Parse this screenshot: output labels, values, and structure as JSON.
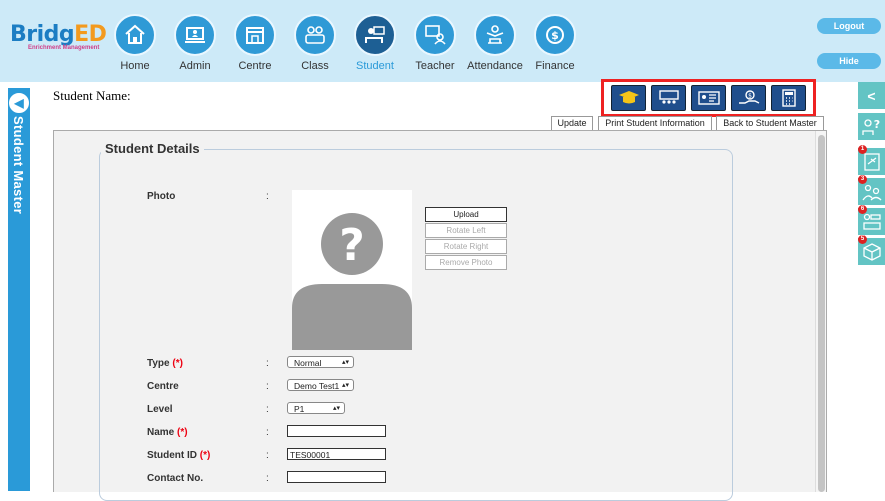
{
  "brand": {
    "name_part1": "Bridg",
    "name_part2": "ED",
    "tagline": "Enrichment Management"
  },
  "nav": [
    {
      "label": "Home",
      "icon": "home-icon"
    },
    {
      "label": "Admin",
      "icon": "admin-icon"
    },
    {
      "label": "Centre",
      "icon": "centre-icon"
    },
    {
      "label": "Class",
      "icon": "class-icon"
    },
    {
      "label": "Student",
      "icon": "student-icon",
      "active": true
    },
    {
      "label": "Teacher",
      "icon": "teacher-icon"
    },
    {
      "label": "Attendance",
      "icon": "attendance-icon"
    },
    {
      "label": "Finance",
      "icon": "finance-icon"
    }
  ],
  "top_buttons": {
    "logout": "Logout",
    "hide": "Hide"
  },
  "side_tab": {
    "label": "Student Master"
  },
  "header": {
    "student_name_label": "Student Name:"
  },
  "actions": {
    "update": "Update",
    "print": "Print Student Information",
    "back": "Back to Student Master"
  },
  "section": {
    "title": "Student Details"
  },
  "form": {
    "photo_label": "Photo",
    "photo_buttons": {
      "upload": "Upload",
      "rotate_left": "Rotate Left",
      "rotate_right": "Rotate Right",
      "remove": "Remove Photo"
    },
    "type_label": "Type",
    "type_value": "Normal",
    "centre_label": "Centre",
    "centre_value": "Demo Test1",
    "level_label": "Level",
    "level_value": "P1",
    "name_label": "Name",
    "name_value": "",
    "student_id_label": "Student ID",
    "student_id_value": "TES00001",
    "contact_label": "Contact No.",
    "contact_value": "",
    "required_mark": "(*)",
    "colon": ":"
  },
  "right_sidebar": {
    "collapse_glyph": "<",
    "badges": [
      "1",
      "3",
      "6",
      "5"
    ]
  },
  "colors": {
    "topbar": "#cdeaf8",
    "nav_circle": "#2f9ad6",
    "nav_active": "#1d5f94",
    "side_tab": "#2a9ad8",
    "highlight_box": "#e22222",
    "right_bar": "#63c4c4"
  }
}
